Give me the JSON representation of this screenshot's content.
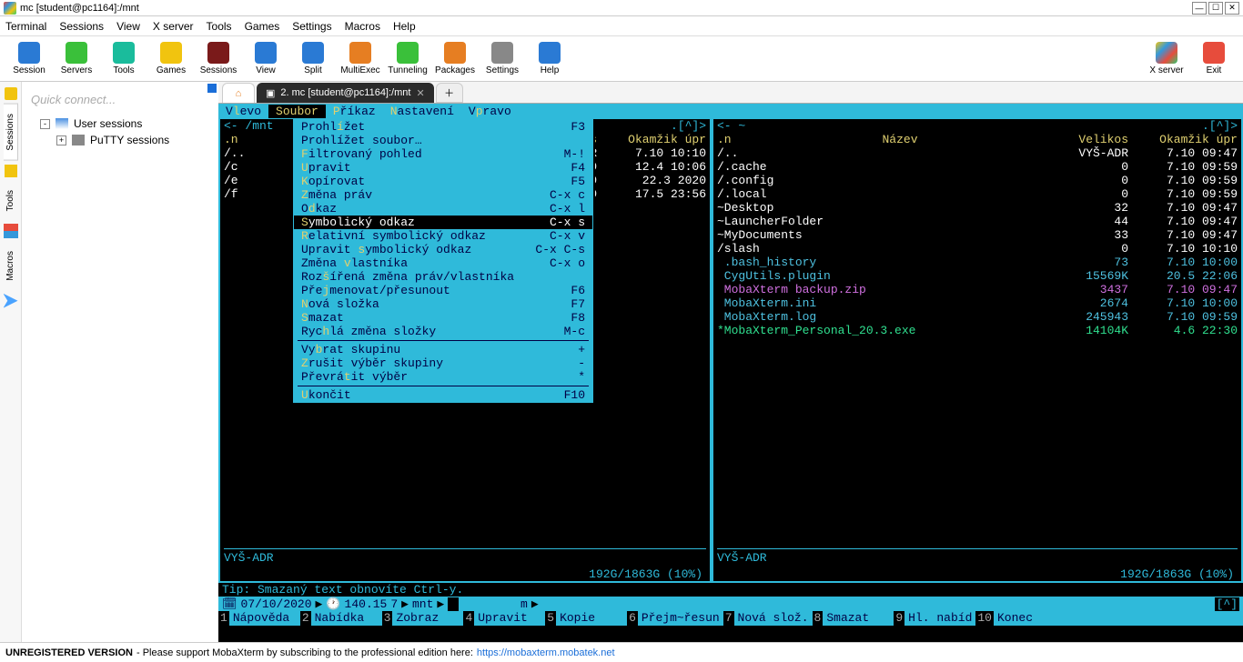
{
  "window": {
    "title": "mc [student@pc1164]:/mnt"
  },
  "menubar": [
    "Terminal",
    "Sessions",
    "View",
    "X server",
    "Tools",
    "Games",
    "Settings",
    "Macros",
    "Help"
  ],
  "toolbar": [
    {
      "label": "Session",
      "color": "sq-blue"
    },
    {
      "label": "Servers",
      "color": "sq-green"
    },
    {
      "label": "Tools",
      "color": "sq-teal"
    },
    {
      "label": "Games",
      "color": "sq-yel"
    },
    {
      "label": "Sessions",
      "color": "sq-darkred"
    },
    {
      "label": "View",
      "color": "sq-blue"
    },
    {
      "label": "Split",
      "color": "sq-blue"
    },
    {
      "label": "MultiExec",
      "color": "sq-orange"
    },
    {
      "label": "Tunneling",
      "color": "sq-green"
    },
    {
      "label": "Packages",
      "color": "sq-orange"
    },
    {
      "label": "Settings",
      "color": "sq-grey"
    },
    {
      "label": "Help",
      "color": "sq-blue"
    }
  ],
  "toolbar_right": [
    {
      "label": "X server",
      "color": "sq-x"
    },
    {
      "label": "Exit",
      "color": "sq-red"
    }
  ],
  "sidebar": {
    "quick": "Quick connect...",
    "vtabs": [
      "Sessions",
      "Tools",
      "Macros"
    ],
    "tree": [
      {
        "label": "User sessions",
        "expand": "-"
      },
      {
        "label": "PuTTY sessions",
        "expand": "+",
        "indent": 1
      }
    ]
  },
  "tabs": {
    "term_label": "2. mc [student@pc1164]:/mnt"
  },
  "mc": {
    "menu": [
      {
        "pre": "V",
        "hk": "l",
        "post": "evo"
      },
      {
        "pre": "",
        "hk": "S",
        "post": "oubor",
        "sel": true
      },
      {
        "pre": "",
        "hk": "P",
        "post": "říkaz"
      },
      {
        "pre": "",
        "hk": "N",
        "post": "astavení"
      },
      {
        "pre": "V",
        "hk": "p",
        "post": "ravo"
      }
    ],
    "left": {
      "path": "<-  /mnt",
      "cols": {
        "n": ".n",
        "s": "kos",
        "d": "Okamžik úpr"
      },
      "rows": [
        {
          "fn": "/..",
          "sz": "ADR",
          "dt": " 7.10 10:10",
          "cls": "dir"
        },
        {
          "fn": "/c",
          "sz": "0",
          "dt": "12.4 10:06",
          "cls": "dir"
        },
        {
          "fn": "/e",
          "sz": "0",
          "dt": "22.3  2020",
          "cls": "dir"
        },
        {
          "fn": "/f",
          "sz": "0",
          "dt": "17.5 23:56",
          "cls": "dir"
        }
      ],
      "status": "VYŠ-ADR",
      "disk": "192G/1863G (10%)"
    },
    "right": {
      "path": "<- ~",
      "cols": {
        "n": ".n",
        "nc": "Název",
        "s": "Velikos",
        "d": "Okamžik úpr"
      },
      "rows": [
        {
          "fn": "/..",
          "sz": "VYŠ-ADR",
          "dt": " 7.10 09:47",
          "cls": "dir"
        },
        {
          "fn": "/.cache",
          "sz": "0",
          "dt": " 7.10 09:59",
          "cls": "dir"
        },
        {
          "fn": "/.config",
          "sz": "0",
          "dt": " 7.10 09:59",
          "cls": "dir"
        },
        {
          "fn": "/.local",
          "sz": "0",
          "dt": " 7.10 09:59",
          "cls": "dir"
        },
        {
          "fn": "~Desktop",
          "sz": "32",
          "dt": " 7.10 09:47",
          "cls": "dir"
        },
        {
          "fn": "~LauncherFolder",
          "sz": "44",
          "dt": " 7.10 09:47",
          "cls": "dir"
        },
        {
          "fn": "~MyDocuments",
          "sz": "33",
          "dt": " 7.10 09:47",
          "cls": "dir"
        },
        {
          "fn": "/slash",
          "sz": "0",
          "dt": " 7.10 10:10",
          "cls": "dir"
        },
        {
          "fn": " .bash_history",
          "sz": "73",
          "dt": " 7.10 10:00",
          "cls": ""
        },
        {
          "fn": " CygUtils.plugin",
          "sz": "15569K",
          "dt": "20.5 22:06",
          "cls": ""
        },
        {
          "fn": " MobaXterm backup.zip",
          "sz": "3437",
          "dt": " 7.10 09:47",
          "cls": "special"
        },
        {
          "fn": " MobaXterm.ini",
          "sz": "2674",
          "dt": " 7.10 10:00",
          "cls": ""
        },
        {
          "fn": " MobaXterm.log",
          "sz": "245943",
          "dt": " 7.10 09:59",
          "cls": ""
        },
        {
          "fn": "*MobaXterm_Personal_20.3.exe",
          "sz": "14104K",
          "dt": " 4.6 22:30",
          "cls": "exec"
        }
      ],
      "status": "VYŠ-ADR",
      "disk": "192G/1863G (10%)"
    },
    "dropdown": [
      {
        "lbl": "Prohlížet",
        "hk": 5,
        "sc": "F3"
      },
      {
        "lbl": "Prohlížet soubor…",
        "hk": 9,
        "sc": ""
      },
      {
        "lbl": "Filtrovaný pohled",
        "hk": 0,
        "sc": "M-!"
      },
      {
        "lbl": "Upravit",
        "hk": 0,
        "sc": "F4"
      },
      {
        "lbl": "Kopírovat",
        "hk": 0,
        "sc": "F5"
      },
      {
        "lbl": "Změna práv",
        "hk": 0,
        "sc": "C-x c"
      },
      {
        "lbl": "Odkaz",
        "hk": 1,
        "sc": "C-x l"
      },
      {
        "lbl": "Symbolický odkaz",
        "hk": 0,
        "sc": "C-x s",
        "sel": true
      },
      {
        "lbl": "Relativní symbolický odkaz",
        "hk": 0,
        "sc": "C-x v"
      },
      {
        "lbl": "Upravit symbolický odkaz",
        "hk": 8,
        "sc": "C-x C-s"
      },
      {
        "lbl": "Změna vlastníka",
        "hk": 6,
        "sc": "C-x o"
      },
      {
        "lbl": "Rozšířená změna práv/vlastníka",
        "hk": 3,
        "sc": ""
      },
      {
        "lbl": "Přejmenovat/přesunout",
        "hk": 3,
        "sc": "F6"
      },
      {
        "lbl": "Nová složka",
        "hk": 0,
        "sc": "F7"
      },
      {
        "lbl": "Smazat",
        "hk": 0,
        "sc": "F8"
      },
      {
        "lbl": "Rychlá změna složky",
        "hk": 3,
        "sc": "M-c"
      },
      {
        "sep": true
      },
      {
        "lbl": "Vybrat skupinu",
        "hk": 2,
        "sc": "+"
      },
      {
        "lbl": "Zrušit výběr skupiny",
        "hk": 0,
        "sc": "-"
      },
      {
        "lbl": "Převrátit výběr",
        "hk": 6,
        "sc": "*"
      },
      {
        "sep": true
      },
      {
        "lbl": "Ukončit",
        "hk": 0,
        "sc": "F10"
      }
    ],
    "tip": "Tip: Smazaný text obnovíte Ctrl-y.",
    "statbar": {
      "date": "07/10/2020",
      "time": "140.15",
      "n": "7",
      "path": "mnt",
      "m": "m"
    },
    "fkeys": [
      {
        "n": "1",
        "l": "Nápověda"
      },
      {
        "n": "2",
        "l": "Nabídka"
      },
      {
        "n": "3",
        "l": "Zobraz"
      },
      {
        "n": "4",
        "l": "Upravit"
      },
      {
        "n": "5",
        "l": "Kopie"
      },
      {
        "n": "6",
        "l": "Přejm~řesun"
      },
      {
        "n": "7",
        "l": "Nová slož."
      },
      {
        "n": "8",
        "l": "Smazat"
      },
      {
        "n": "9",
        "l": "Hl. nabíd"
      },
      {
        "n": "10",
        "l": "Konec"
      }
    ]
  },
  "bottom": {
    "bold": "UNREGISTERED VERSION",
    "text": " - Please support MobaXterm by subscribing to the professional edition here: ",
    "url": "https://mobaxterm.mobatek.net"
  }
}
